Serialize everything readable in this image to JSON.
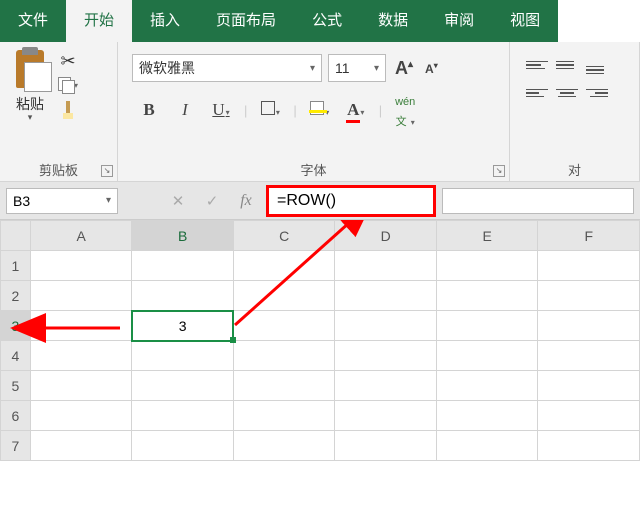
{
  "tabs": {
    "file": "文件",
    "home": "开始",
    "insert": "插入",
    "layout": "页面布局",
    "formula": "公式",
    "data": "数据",
    "review": "审阅",
    "view": "视图"
  },
  "ribbon": {
    "clipboard": {
      "paste": "粘贴",
      "group_label": "剪贴板"
    },
    "font": {
      "name": "微软雅黑",
      "size": "11",
      "group_label": "字体",
      "wen_top": "wén",
      "wen_bot": "文"
    },
    "alignment": {
      "group_label": "对"
    }
  },
  "formula_bar": {
    "cell_ref": "B3",
    "formula": "=ROW()"
  },
  "grid": {
    "columns": [
      "A",
      "B",
      "C",
      "D",
      "E",
      "F"
    ],
    "rows": [
      "1",
      "2",
      "3",
      "4",
      "5",
      "6",
      "7"
    ],
    "selected_cell_value": "3"
  }
}
